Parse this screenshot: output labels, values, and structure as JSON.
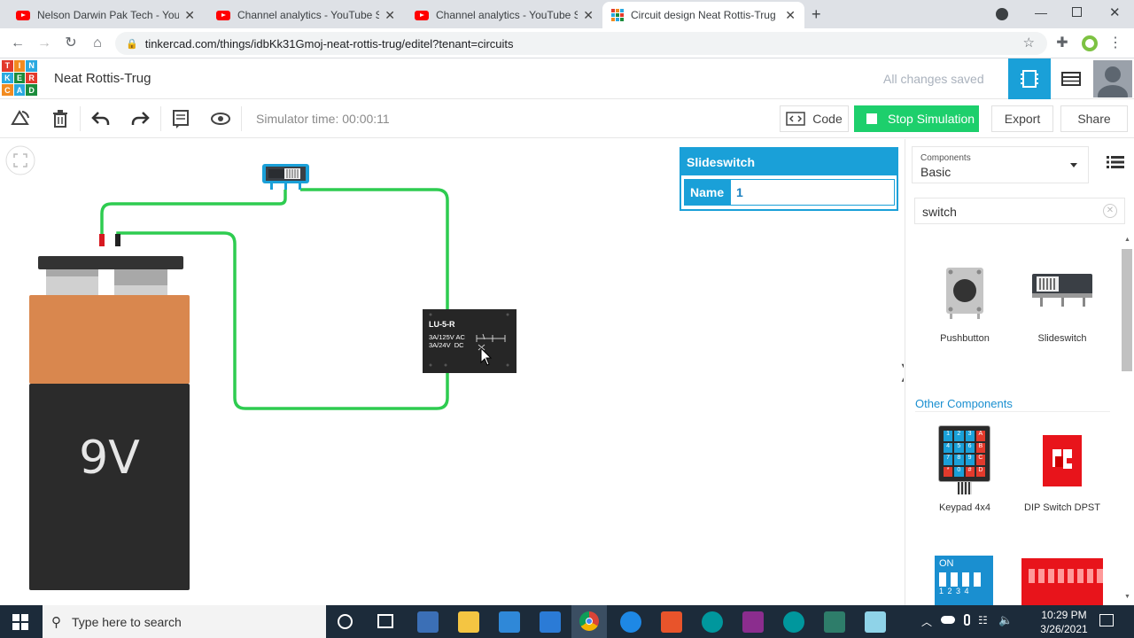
{
  "browser": {
    "tabs": [
      {
        "title": "Nelson Darwin Pak Tech - YouTube",
        "icon": "youtube-icon"
      },
      {
        "title": "Channel analytics - YouTube Studio",
        "icon": "youtube-icon"
      },
      {
        "title": "Channel analytics - YouTube Studio",
        "icon": "youtube-icon"
      },
      {
        "title": "Circuit design Neat Rottis-Trug | Tinkercad",
        "icon": "tinkercad-icon",
        "active": true
      }
    ],
    "url": "tinkercad.com/things/idbKk31Gmoj-neat-rottis-trug/editel?tenant=circuits"
  },
  "app": {
    "logo_letters": [
      "T",
      "I",
      "N",
      "K",
      "E",
      "R",
      "C",
      "A",
      "D"
    ],
    "project_name": "Neat Rottis-Trug",
    "save_status": "All changes saved"
  },
  "toolbar": {
    "sim_time": "Simulator time: 00:00:11",
    "code_label": "Code",
    "stop_label": "Stop Simulation",
    "export_label": "Export",
    "share_label": "Share"
  },
  "canvas": {
    "battery_label": "9V",
    "relay": {
      "title": "LU-5-R",
      "line1": "3A/125V AC",
      "line2": "3A/24V  DC"
    }
  },
  "inspector": {
    "title": "Slideswitch",
    "name_label": "Name",
    "name_value": "1"
  },
  "panel": {
    "components_small": "Components",
    "components_value": "Basic",
    "search_value": "switch",
    "results": [
      {
        "label": "Pushbutton"
      },
      {
        "label": "Slideswitch"
      }
    ],
    "other_heading": "Other Components",
    "others": [
      {
        "label": "Keypad 4x4"
      },
      {
        "label": "DIP Switch DPST"
      }
    ],
    "dip_on_label": "ON",
    "dip_numbers": "1 2 3 4",
    "keypad_keys": [
      "1",
      "2",
      "3",
      "A",
      "4",
      "5",
      "6",
      "B",
      "7",
      "8",
      "9",
      "C",
      "*",
      "0",
      "#",
      "D"
    ]
  },
  "taskbar": {
    "search_placeholder": "Type here to search",
    "time": "10:29 PM",
    "date": "3/26/2021"
  },
  "colors": {
    "accent": "#1aa0d8",
    "stop_green": "#1dcf6c",
    "wire_green": "#2ecc50",
    "battery_top": "#d9874e",
    "battery_body": "#2b2b2b"
  }
}
